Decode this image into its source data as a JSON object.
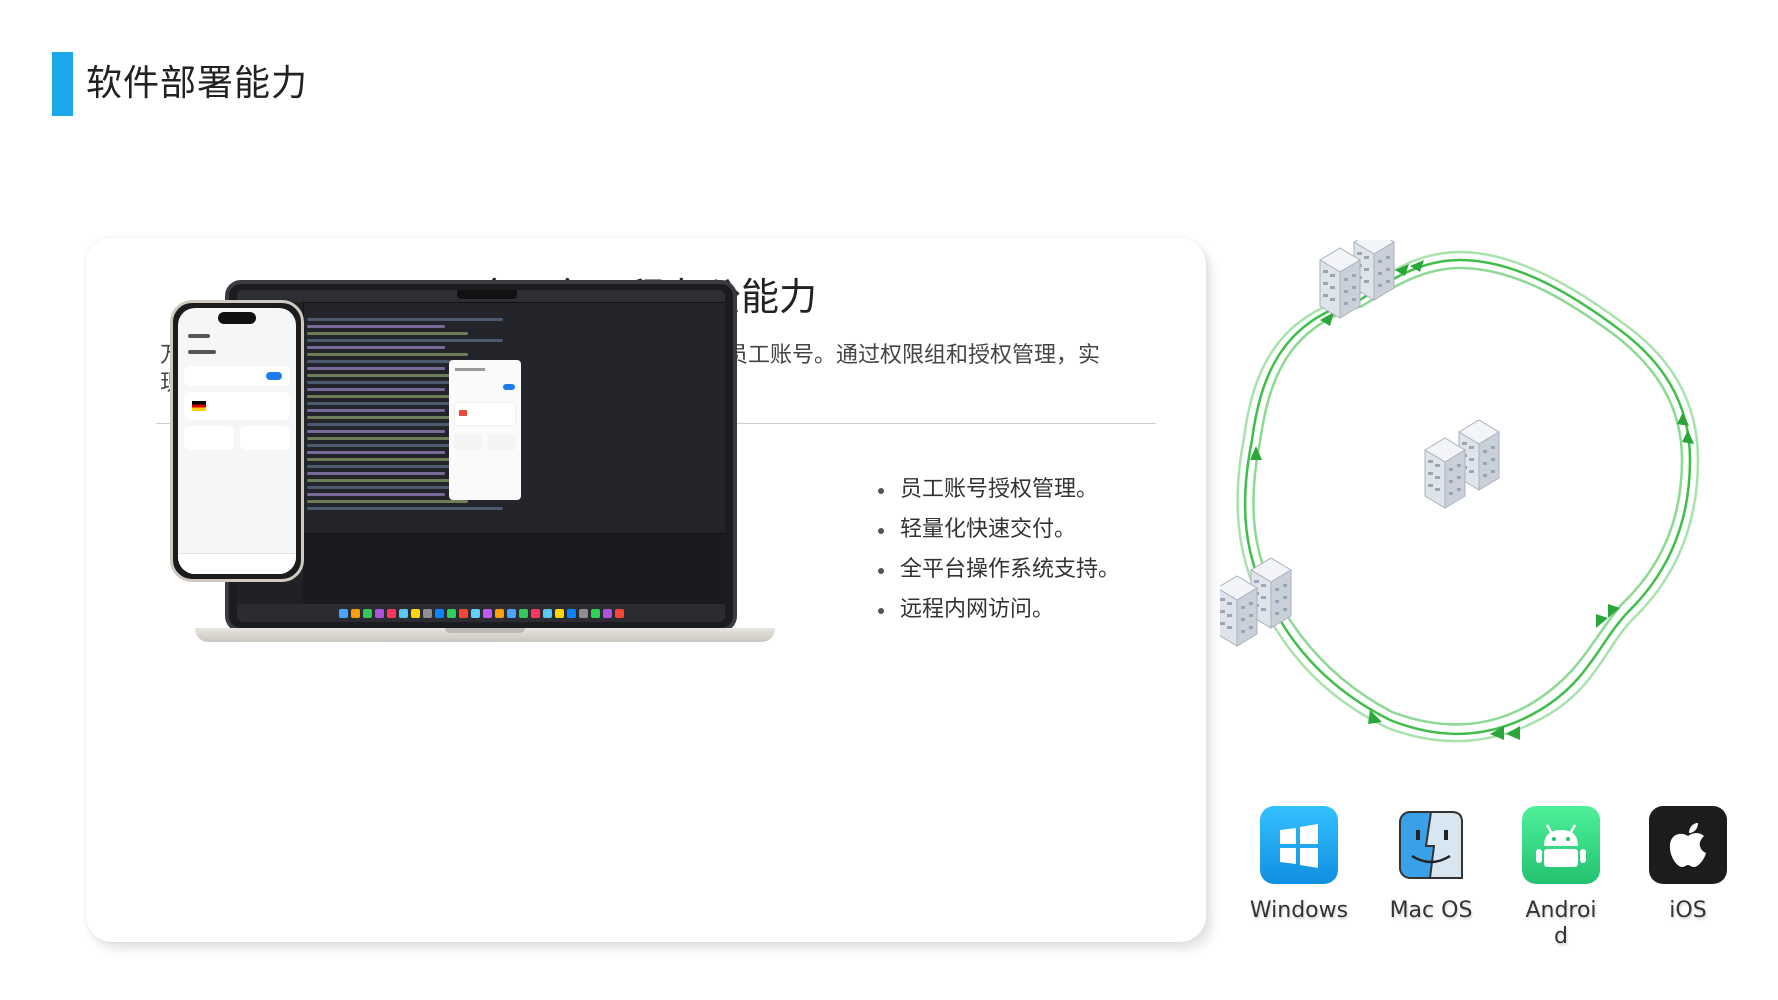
{
  "page": {
    "title": "软件部署能力"
  },
  "card": {
    "title": "全平台远程办公能力",
    "description": "万联 SD-WAN 支持企业在系统中自行管理用于远程办公的员工账号。通过权限组和授权管理，实现复杂的企业内部权限管理。",
    "features": [
      "员工账号授权管理。",
      "轻量化快速交付。",
      "全平台操作系统支持。",
      "远程内网访问。"
    ]
  },
  "diagram": {
    "node_icon": "server-cluster-icon",
    "link_color": "#3fbf4a",
    "node_count": 5
  },
  "platforms": [
    {
      "label": "Windows",
      "icon": "windows-icon",
      "color": "#1fa3ef"
    },
    {
      "label": "Mac OS",
      "icon": "finder-icon",
      "color": "#3aa0e8"
    },
    {
      "label": "Android",
      "icon": "android-icon",
      "color": "#3ddc84"
    },
    {
      "label": "iOS",
      "icon": "apple-icon",
      "color": "#1c1c1e"
    }
  ],
  "colors": {
    "accent": "#1aa7ec"
  }
}
